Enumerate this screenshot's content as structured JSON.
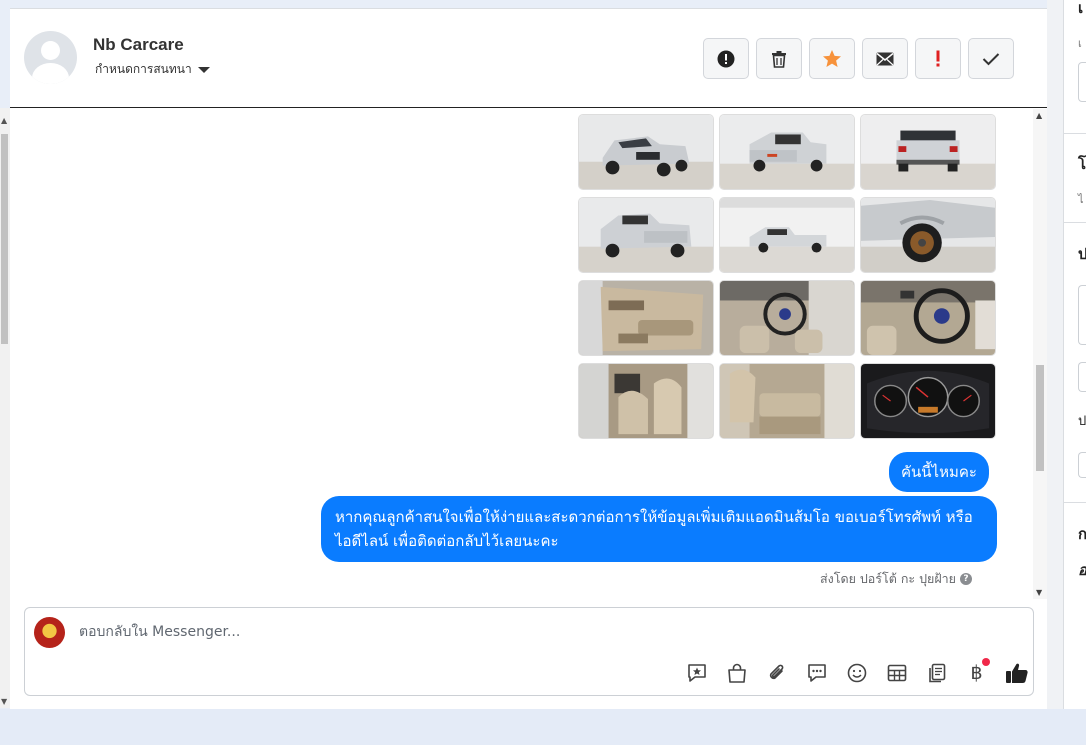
{
  "conversation": {
    "contact_name": "Nb Carcare",
    "assign_label": "กำหนดการสนทนา"
  },
  "toolbar": {
    "buttons": [
      {
        "name": "report-spam",
        "icon": "alert-circle-icon"
      },
      {
        "name": "delete",
        "icon": "trash-icon"
      },
      {
        "name": "star",
        "icon": "star-icon",
        "color": "#f7923b"
      },
      {
        "name": "mark-unread",
        "icon": "envelope-icon"
      },
      {
        "name": "mark-important",
        "icon": "exclamation-icon",
        "color": "#e02020"
      },
      {
        "name": "mark-done",
        "icon": "check-icon"
      }
    ]
  },
  "gallery": {
    "photos": [
      {
        "subject": "pickup-front-3q"
      },
      {
        "subject": "pickup-rear"
      },
      {
        "subject": "pickup-rear-straight"
      },
      {
        "subject": "pickup-rear-3q"
      },
      {
        "subject": "pickup-side-far"
      },
      {
        "subject": "wheel-closeup"
      },
      {
        "subject": "door-interior"
      },
      {
        "subject": "steering-wheel"
      },
      {
        "subject": "dashboard-steering"
      },
      {
        "subject": "front-seats"
      },
      {
        "subject": "rear-cab-seat"
      },
      {
        "subject": "gauge-cluster"
      }
    ]
  },
  "messages": {
    "short": "คันนี้ไหมคะ",
    "long": "หากคุณลูกค้าสนใจเพื่อให้ง่ายและสะดวกต่อการให้ข้อมูลเพิ่มเติมแอดมินส้มโอ ขอเบอร์โทรศัพท์ หรือ ไอดีไลน์ เพื่อติดต่อกลับไว้เลยนะคะ",
    "sent_by": "ส่งโดย ปอร์โต้ กะ ปุยฝ้าย",
    "bubble_color": "#0a7cff"
  },
  "composer": {
    "placeholder": "ตอบกลับใน Messenger...",
    "tools": [
      "saved-reply-icon",
      "shop-bag-icon",
      "attachment-icon",
      "chat-bubble-icon",
      "emoji-icon",
      "table-icon",
      "catalog-icon",
      "baht-icon",
      "like-icon"
    ],
    "baht_symbol": "฿"
  },
  "sidebar": {
    "letters": [
      "เ",
      "เ",
      "โ",
      "ไ",
      "ป",
      "ป",
      "ก",
      "อ"
    ]
  }
}
